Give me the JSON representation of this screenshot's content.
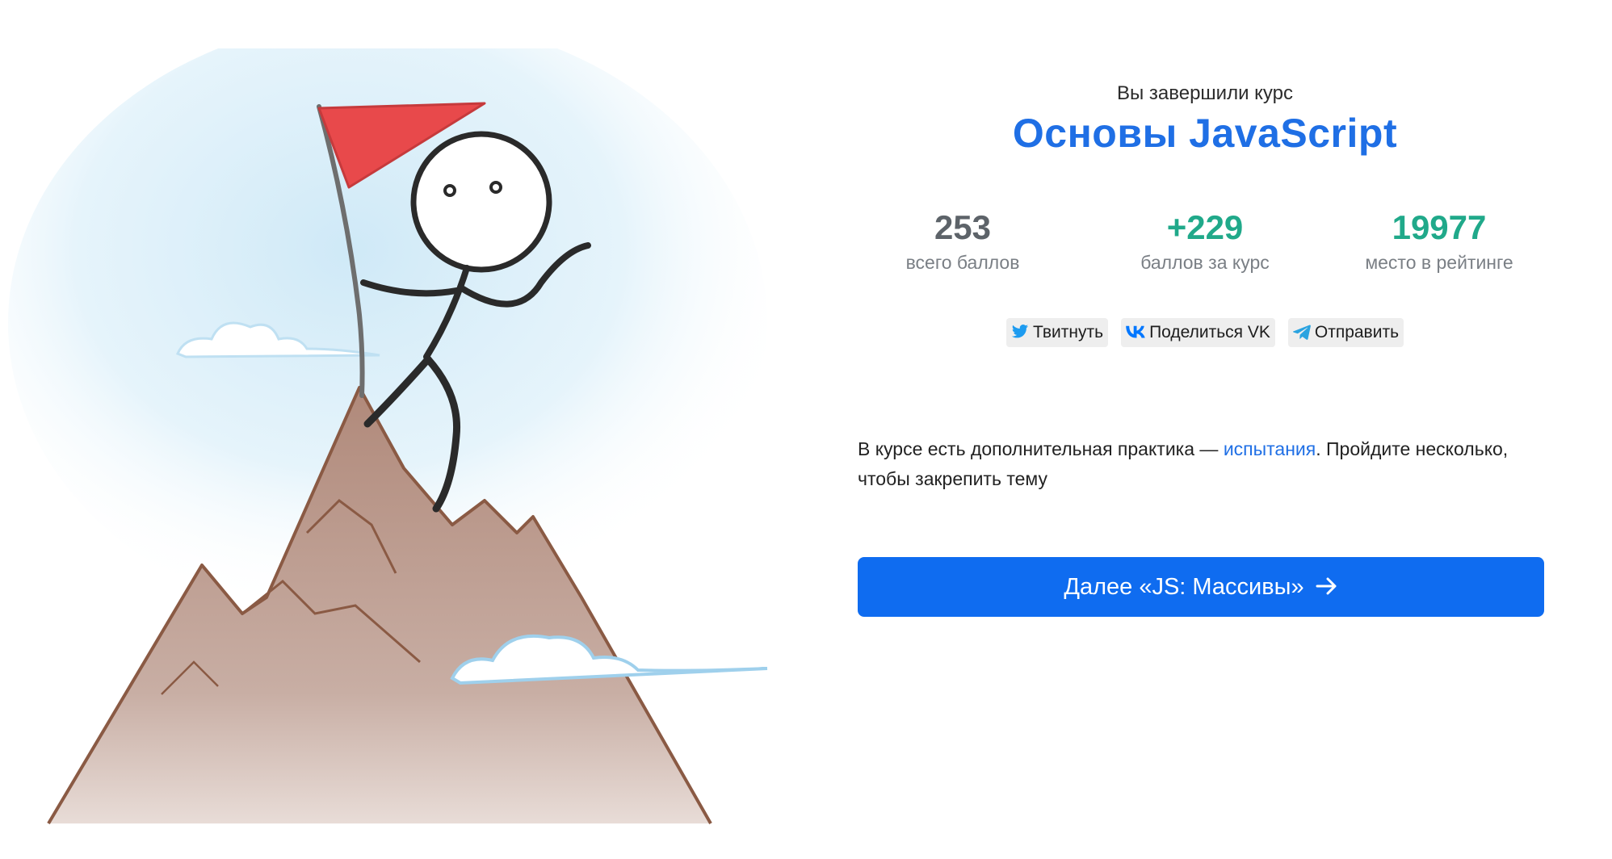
{
  "completion": {
    "label": "Вы завершили курс",
    "course_title": "Основы JavaScript"
  },
  "stats": [
    {
      "value": "253",
      "label": "всего баллов",
      "color": "#5d6369"
    },
    {
      "value": "+229",
      "label": "баллов за курс",
      "color": "#20a98a"
    },
    {
      "value": "19977",
      "label": "место в рейтинге",
      "color": "#20a98a"
    }
  ],
  "share": {
    "twitter_label": "Твитнуть",
    "vk_label": "Поделиться VK",
    "telegram_label": "Отправить",
    "twitter_icon": "twitter-bird-icon",
    "vk_icon": "vk-logo-icon",
    "telegram_icon": "telegram-plane-icon"
  },
  "practice": {
    "text_before": "В курсе есть дополнительная практика — ",
    "link_text": "испытания",
    "text_after": ". Пройдите несколько, чтобы закрепить тему"
  },
  "next_button": {
    "label": "Далее «JS: Массивы»",
    "icon": "arrow-right-icon"
  },
  "colors": {
    "accent_blue": "#1f6fe5",
    "button_blue": "#0f6cf0",
    "green": "#20a98a",
    "flag_red": "#e8494b"
  }
}
